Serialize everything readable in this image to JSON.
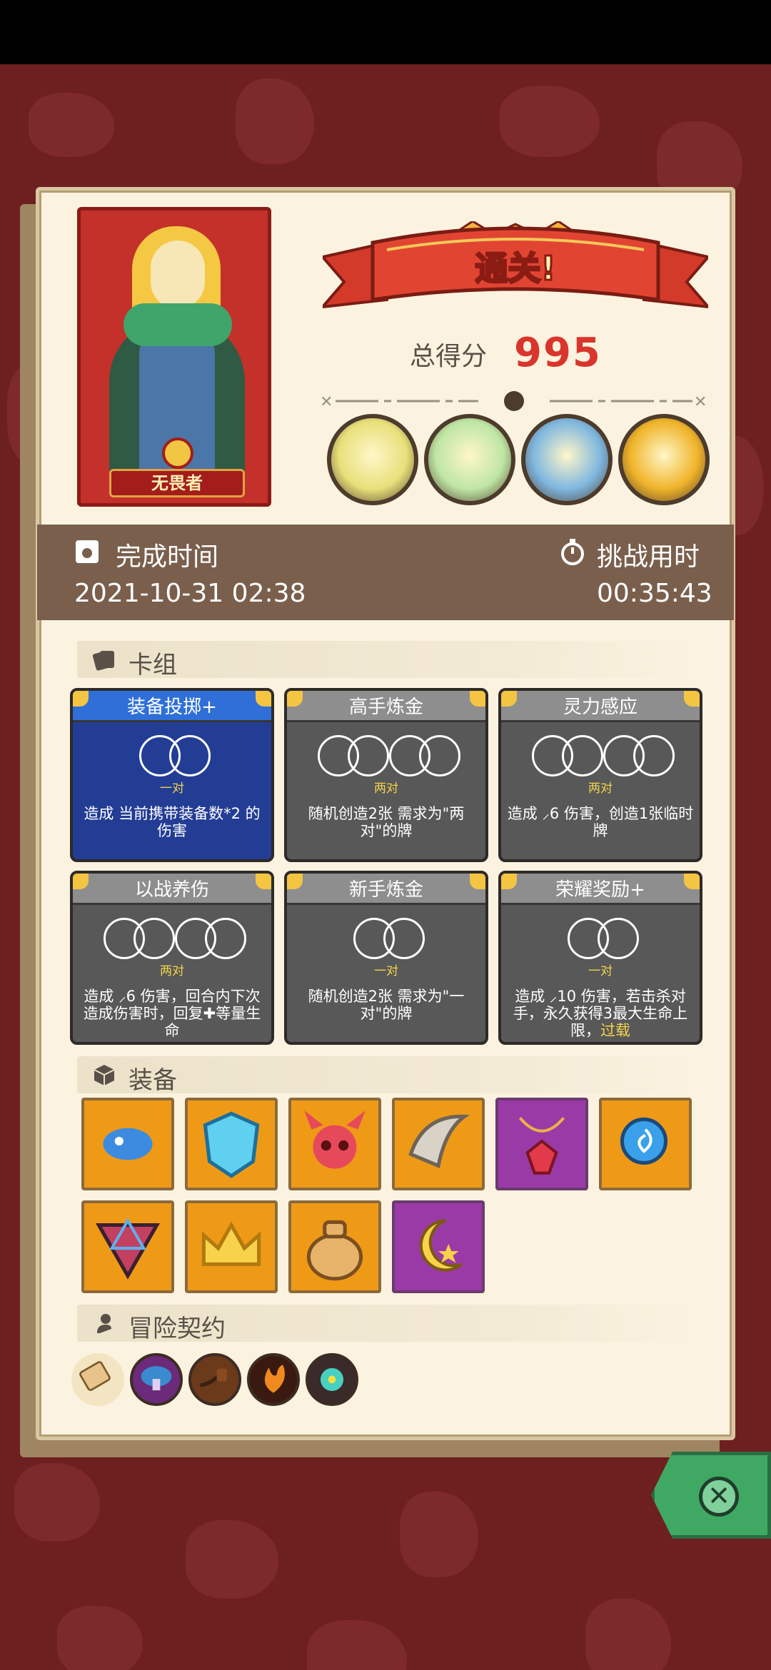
{
  "hero": {
    "name": "无畏者"
  },
  "result": {
    "banner": "通关!",
    "score_label": "总得分",
    "score_value": "995"
  },
  "bosses": [
    {
      "icon": "skeleton-dinosaur-boss-icon",
      "color": "#e8e07a"
    },
    {
      "icon": "dragon-boss-icon",
      "color": "#bfe6a4"
    },
    {
      "icon": "shark-boss-icon",
      "color": "#7fb7e0"
    },
    {
      "icon": "pumpkin-boss-icon",
      "color": "#f0b42a"
    }
  ],
  "times": {
    "finish_label": "完成时间",
    "finish_value": "2021-10-31 02:38",
    "duration_label": "挑战用时",
    "duration_value": "00:35:43"
  },
  "sections": {
    "deck": "卡组",
    "equipment": "装备",
    "contracts": "冒险契约"
  },
  "cards": [
    {
      "title": "装备投掷+",
      "pair": "一对",
      "desc": "造成 当前携带装备数*2 的伤害",
      "rings": 1,
      "style": "blue"
    },
    {
      "title": "高手炼金",
      "pair": "两对",
      "desc": "随机创造2张 需求为\"两对\"的牌",
      "rings": 2,
      "style": "gray"
    },
    {
      "title": "灵力感应",
      "pair": "两对",
      "desc": "造成 ⸝6 伤害，创造1张临时牌",
      "rings": 2,
      "style": "gray"
    },
    {
      "title": "以战养伤",
      "pair": "两对",
      "desc": "造成 ⸝6 伤害，回合内下次造成伤害时，回复✚等量生命",
      "rings": 2,
      "style": "gray"
    },
    {
      "title": "新手炼金",
      "pair": "一对",
      "desc": "随机创造2张 需求为\"一对\"的牌",
      "rings": 1,
      "style": "gray"
    },
    {
      "title": "荣耀奖励+",
      "pair": "一对",
      "desc": "造成 ⸝10 伤害，若击杀对手，永久获得3最大生命上限，",
      "desc_highlight": "过载",
      "rings": 1,
      "style": "gray"
    }
  ],
  "equipment": [
    {
      "icon": "blue-mushroom-icon",
      "rarity": "orange"
    },
    {
      "icon": "ice-shield-icon",
      "rarity": "orange"
    },
    {
      "icon": "demon-skull-icon",
      "rarity": "orange"
    },
    {
      "icon": "horn-icon",
      "rarity": "orange"
    },
    {
      "icon": "red-gem-necklace-icon",
      "rarity": "purple"
    },
    {
      "icon": "blue-orb-icon",
      "rarity": "orange"
    },
    {
      "icon": "hexagram-amulet-icon",
      "rarity": "orange"
    },
    {
      "icon": "gold-crown-icon",
      "rarity": "orange"
    },
    {
      "icon": "money-bag-icon",
      "rarity": "orange"
    },
    {
      "icon": "moon-star-icon",
      "rarity": "purple"
    }
  ],
  "contracts": [
    {
      "icon": "scroll-icon"
    },
    {
      "icon": "mushroom-icon"
    },
    {
      "icon": "pipe-icon"
    },
    {
      "icon": "flame-icon"
    },
    {
      "icon": "virus-icon"
    }
  ],
  "colors": {
    "accent_red": "#d9352c",
    "board": "#fbf3df",
    "time_bar": "#7a5f4d"
  }
}
